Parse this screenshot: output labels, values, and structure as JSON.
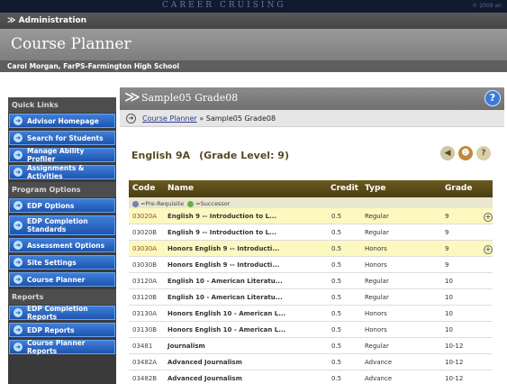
{
  "banner": {
    "text": "CAREER CRUISING",
    "right_text": "© 2009 an"
  },
  "admin_bar": {
    "label": "Administration"
  },
  "header": {
    "title": "Course Planner"
  },
  "user_bar": {
    "label": "Carol Morgan, FarPS-Farmington High School"
  },
  "sidebar": {
    "quick_links": {
      "title": "Quick Links",
      "items": [
        "Advisor Homepage",
        "Search for Students",
        "Manage Ability Profiler",
        "Assignments & Activities"
      ]
    },
    "program_options": {
      "title": "Program Options",
      "items": [
        "EDP Options",
        "EDP Completion Standards",
        "Assessment Options",
        "Site Settings",
        "Course Planner"
      ]
    },
    "reports": {
      "title": "Reports",
      "items": [
        "EDP Completion Reports",
        "EDP Reports",
        "Course Planner Reports"
      ]
    }
  },
  "main": {
    "title": "Sample05 Grade08",
    "help_icon": "?",
    "breadcrumb": {
      "link": "Course Planner",
      "sep": " » ",
      "current": "Sample05 Grade08"
    },
    "course": {
      "name": "English 9A",
      "grade_level": "(Grade Level: 9)"
    },
    "table": {
      "headers": [
        "Code",
        "Name",
        "Credit",
        "Type",
        "Grade"
      ],
      "legend": {
        "pre": "=Pre-Requisite",
        "suc": "=Successor"
      },
      "rows": [
        {
          "code": "03020A",
          "name": "English 9 -- Introduction to L...",
          "credit": "0.5",
          "type": "Regular",
          "grade": "9",
          "highlight": true,
          "plus": true
        },
        {
          "code": "03020B",
          "name": "English 9 -- Introduction to L...",
          "credit": "0.5",
          "type": "Regular",
          "grade": "9",
          "highlight": false,
          "plus": false
        },
        {
          "code": "03030A",
          "name": "Honors English 9 -- Introducti...",
          "credit": "0.5",
          "type": "Honors",
          "grade": "9",
          "highlight": true,
          "plus": true
        },
        {
          "code": "03030B",
          "name": "Honors English 9 -- Introducti...",
          "credit": "0.5",
          "type": "Honors",
          "grade": "9",
          "highlight": false,
          "plus": false
        },
        {
          "code": "03120A",
          "name": "English 10 - American Literatu...",
          "credit": "0.5",
          "type": "Regular",
          "grade": "10",
          "highlight": false,
          "plus": false
        },
        {
          "code": "03120B",
          "name": "English 10 - American Literatu...",
          "credit": "0.5",
          "type": "Regular",
          "grade": "10",
          "highlight": false,
          "plus": false
        },
        {
          "code": "03130A",
          "name": "Honors English 10 - American L...",
          "credit": "0.5",
          "type": "Honors",
          "grade": "10",
          "highlight": false,
          "plus": false
        },
        {
          "code": "03130B",
          "name": "Honors English 10 - American L...",
          "credit": "0.5",
          "type": "Honors",
          "grade": "10",
          "highlight": false,
          "plus": false
        },
        {
          "code": "03481",
          "name": "Journalism",
          "credit": "0.5",
          "type": "Regular",
          "grade": "10-12",
          "highlight": false,
          "plus": false
        },
        {
          "code": "03482A",
          "name": "Advanced Journalism",
          "credit": "0.5",
          "type": "Advance",
          "grade": "10-12",
          "highlight": false,
          "plus": false
        },
        {
          "code": "03482B",
          "name": "Advanced Journalism",
          "credit": "0.5",
          "type": "Advance",
          "grade": "10-12",
          "highlight": false,
          "plus": false
        }
      ]
    }
  }
}
